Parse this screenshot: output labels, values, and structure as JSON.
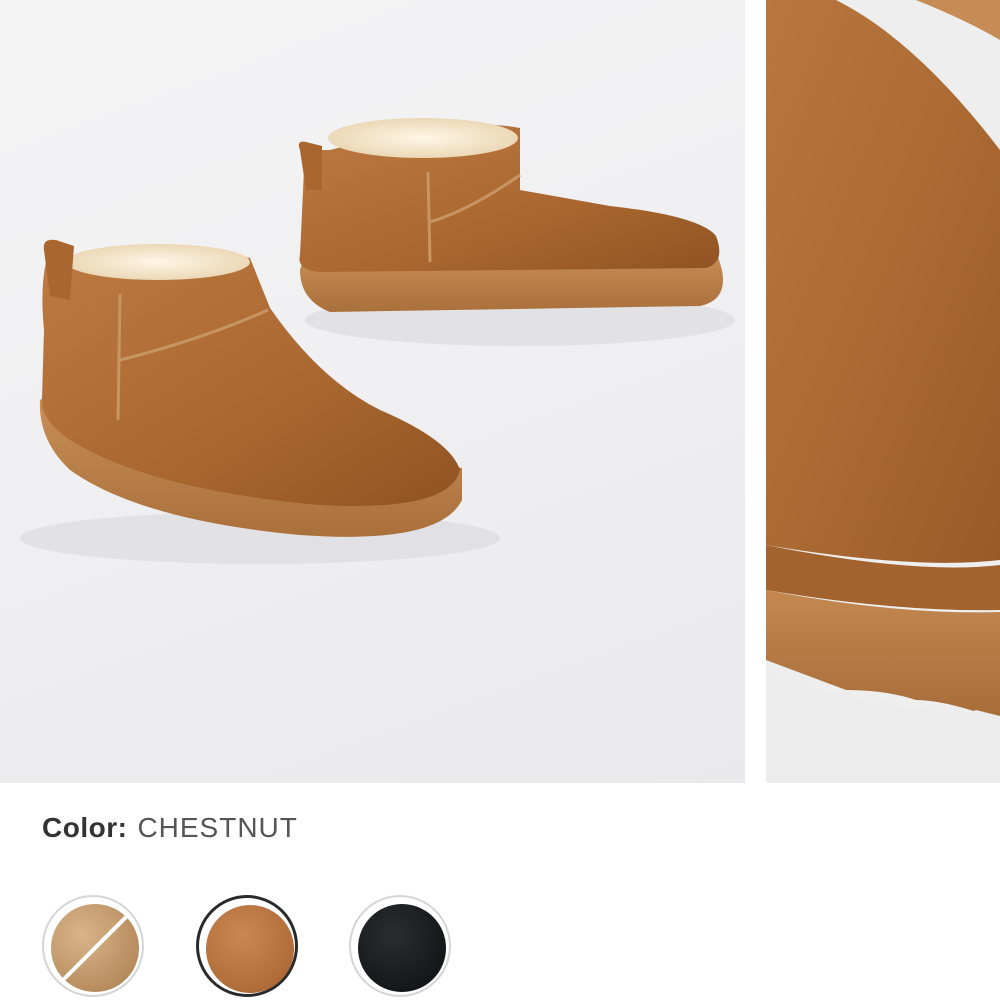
{
  "product": {
    "images": [
      {
        "icon": "ankle-boots-pair-photo"
      },
      {
        "icon": "boot-suede-closeup-photo"
      }
    ],
    "color": {
      "label": "Color:",
      "selected": "CHESTNUT",
      "swatches": [
        {
          "icon": "tan-suede-swatch",
          "hex": "#c49a6a",
          "state": "unavailable"
        },
        {
          "icon": "chestnut-suede-swatch",
          "hex": "#b06d39",
          "state": "selected"
        },
        {
          "icon": "black-suede-swatch",
          "hex": "#16171a",
          "state": "available"
        }
      ]
    }
  }
}
